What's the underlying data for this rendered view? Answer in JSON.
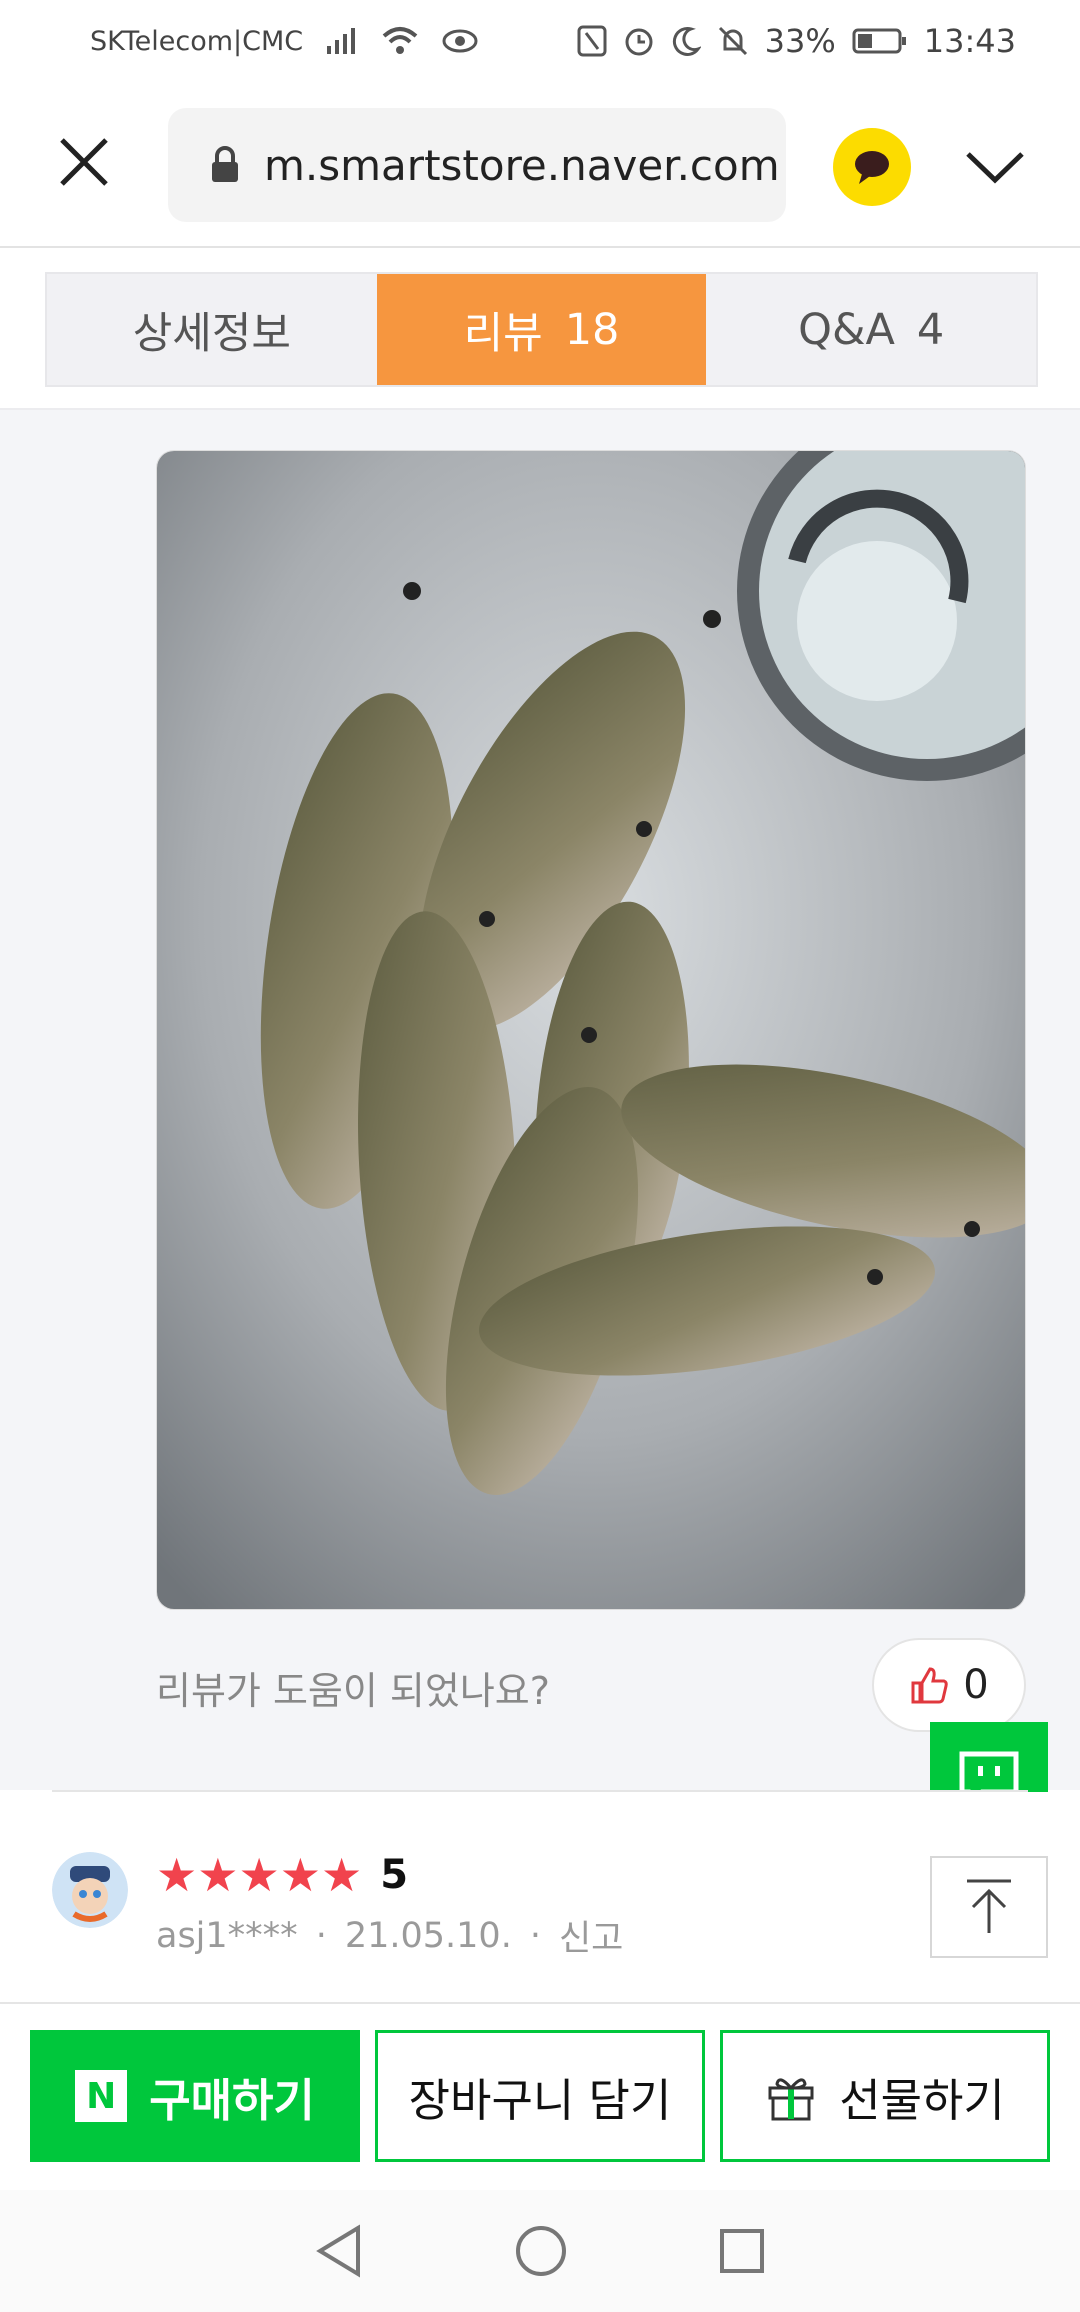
{
  "status_bar": {
    "carrier": "SKTelecom|CMC",
    "battery": "33%",
    "time": "13:43"
  },
  "browser": {
    "url": "m.smartstore.naver.com"
  },
  "tabs": [
    {
      "label": "상세정보",
      "count": ""
    },
    {
      "label": "리뷰",
      "count": "18"
    },
    {
      "label": "Q&A",
      "count": "4"
    }
  ],
  "review": {
    "helpful_prompt": "리뷰가 도움이 되었나요?",
    "like_count": "0"
  },
  "next_review": {
    "stars": "★★★★★",
    "rating": "5",
    "user": "asj1****",
    "date": "21.05.10.",
    "report": "신고",
    "sep": "·"
  },
  "actions": {
    "buy_icon": "N",
    "buy": "구매하기",
    "cart": "장바구니 담기",
    "gift": "선물하기"
  },
  "colors": {
    "accent": "#f6963f",
    "naver_green": "#00c73c",
    "star": "#f1434d"
  }
}
